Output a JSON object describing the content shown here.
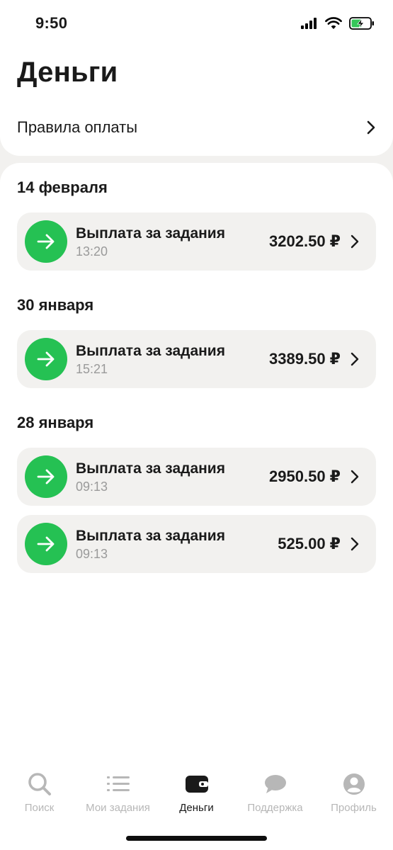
{
  "status_bar": {
    "time": "9:50"
  },
  "header": {
    "title": "Деньги",
    "rules_label": "Правила оплаты"
  },
  "groups": [
    {
      "date": "14 февраля",
      "payments": [
        {
          "title": "Выплата за задания",
          "time": "13:20",
          "amount": "3202.50 ₽"
        }
      ]
    },
    {
      "date": "30 января",
      "payments": [
        {
          "title": "Выплата за задания",
          "time": "15:21",
          "amount": "3389.50 ₽"
        }
      ]
    },
    {
      "date": "28 января",
      "payments": [
        {
          "title": "Выплата за задания",
          "time": "09:13",
          "amount": "2950.50 ₽"
        },
        {
          "title": "Выплата за задания",
          "time": "09:13",
          "amount": "525.00 ₽"
        }
      ]
    }
  ],
  "tabs": [
    {
      "label": "Поиск",
      "icon": "search-icon",
      "active": false
    },
    {
      "label": "Мои задания",
      "icon": "list-icon",
      "active": false
    },
    {
      "label": "Деньги",
      "icon": "wallet-icon",
      "active": true
    },
    {
      "label": "Поддержка",
      "icon": "chat-icon",
      "active": false
    },
    {
      "label": "Профиль",
      "icon": "profile-icon",
      "active": false
    }
  ],
  "colors": {
    "accent_green": "#25c153",
    "background": "#f2f1ef",
    "inactive_tab": "#b7b7b7"
  }
}
